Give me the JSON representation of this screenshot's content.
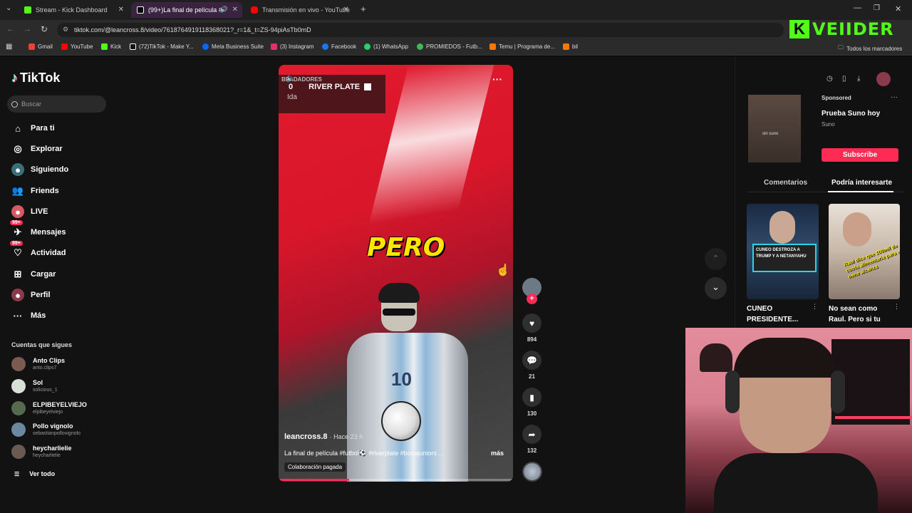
{
  "browser": {
    "tabs": [
      {
        "title": "Stream - Kick Dashboard",
        "favicon_color": "#53fc18"
      },
      {
        "title": "(99+)La final de película #fu",
        "favicon_color": "#ffffff"
      },
      {
        "title": "Transmisión en vivo - YouTube",
        "favicon_color": "#ff0000"
      }
    ],
    "url": "tiktok.com/@leancross.8/video/7618764919118368021?_r=1&_t=ZS-94piAsTb0mD",
    "bookmarks": [
      {
        "label": "Gmail",
        "color": "#ea4335"
      },
      {
        "label": "YouTube",
        "color": "#ff0000"
      },
      {
        "label": "Kick",
        "color": "#53fc18"
      },
      {
        "label": "(72)TikTok - Make Y...",
        "color": "#ffffff"
      },
      {
        "label": "Meta Business Suite",
        "color": "#0866ff"
      },
      {
        "label": "(3) Instagram",
        "color": "#e1306c"
      },
      {
        "label": "Facebook",
        "color": "#1877f2"
      },
      {
        "label": "(1) WhatsApp",
        "color": "#25d366"
      },
      {
        "label": "PROMIEDOS - Futb...",
        "color": "#3cba54"
      },
      {
        "label": "Temu | Programa de...",
        "color": "#fb7701"
      },
      {
        "label": "bil",
        "color": "#fb7701"
      }
    ],
    "all_bookmarks": "Todos los marcadores"
  },
  "overlay_logo": "VEIIDER",
  "tiktok": {
    "logo": "TikTok",
    "search_placeholder": "Buscar",
    "nav": [
      {
        "label": "Para ti",
        "icon": "home-icon"
      },
      {
        "label": "Explorar",
        "icon": "compass-icon"
      },
      {
        "label": "Siguiendo",
        "icon": "following-icon"
      },
      {
        "label": "Friends",
        "icon": "friends-icon"
      },
      {
        "label": "LIVE",
        "icon": "live-icon"
      },
      {
        "label": "Mensajes",
        "icon": "messages-icon",
        "badge": "99+"
      },
      {
        "label": "Actividad",
        "icon": "activity-icon",
        "badge": "99+"
      },
      {
        "label": "Cargar",
        "icon": "upload-icon"
      },
      {
        "label": "Perfil",
        "icon": "profile-icon"
      },
      {
        "label": "Más",
        "icon": "more-icon"
      }
    ],
    "following_title": "Cuentas que sigues",
    "following": [
      {
        "name": "Anto Clips",
        "handle": "anto.clips7"
      },
      {
        "name": "Sol",
        "handle": "solicious_1"
      },
      {
        "name": "ELPIBEYELVIEJO",
        "handle": "elpibeyelviejo"
      },
      {
        "name": "Pollo vignolo",
        "handle": "sebastianpollovignolo"
      },
      {
        "name": "heycharlielie",
        "handle": "heycharlielie"
      }
    ],
    "see_all": "Ver todo",
    "video": {
      "scoreboard_top": "BEADADORES",
      "scoreboard_score": "0",
      "scoreboard_team": "RIVER PLATE",
      "scoreboard_sub": "Ida",
      "caption_word": "PERO",
      "jersey_number": "10",
      "author": "leancross.8",
      "time": "· Hace 23 h",
      "description": "La final de película #futbol⚽ #riverplate #bocajuniors ...",
      "more": "más",
      "paid": "Colaboración pagada",
      "progress": 0.3
    },
    "actions": [
      {
        "name": "like",
        "icon": "heart-icon",
        "count": "894"
      },
      {
        "name": "comment",
        "icon": "comment-icon",
        "count": "21"
      },
      {
        "name": "save",
        "icon": "bookmark-icon",
        "count": "130"
      },
      {
        "name": "share",
        "icon": "share-icon",
        "count": "132"
      }
    ],
    "sponsored": {
      "label": "Sponsored",
      "title": "Prueba Suno hoy",
      "brand": "Suno",
      "cta": "Subscribe",
      "thumb_text": "sin suno"
    },
    "right_tabs": [
      "Comentarios",
      "Podría interesarte"
    ],
    "suggestions": [
      {
        "title": "CUNEO PRESIDENTE...",
        "thumb_text": "CUNEO DESTROZA A TRUMP Y A NETANYAHU"
      },
      {
        "title": "No sean como Raul. Pero si tu e...",
        "thumb_text": "Raul dice que 100mil de cuota alimentaria para el nene alcanza"
      }
    ]
  }
}
